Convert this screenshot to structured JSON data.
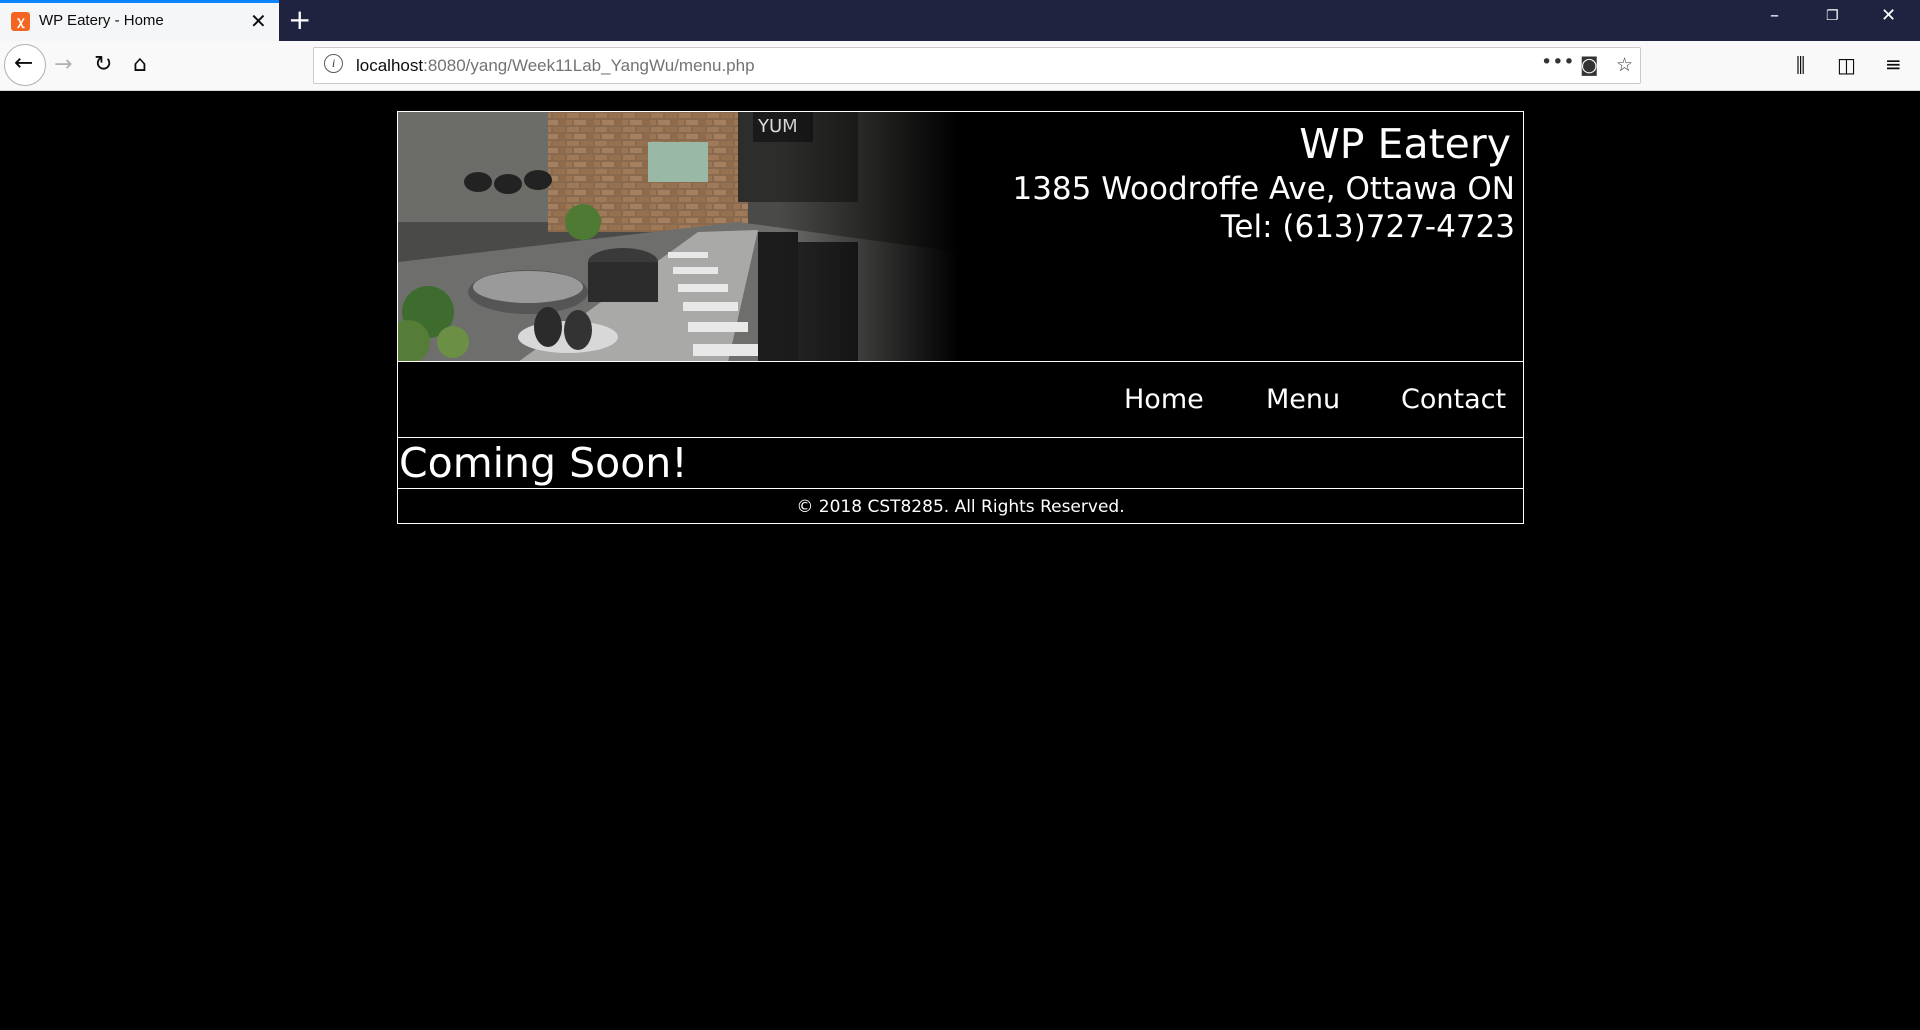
{
  "browser": {
    "tab_title": "WP Eatery - Home",
    "tab_close": "✕",
    "new_tab": "+",
    "url_host": "localhost",
    "url_path": ":8080/yang/Week11Lab_YangWu/menu.php",
    "icons": [
      "back-icon",
      "forward-icon",
      "reload-icon",
      "home-icon",
      "info-icon",
      "page-actions-icon",
      "pocket-icon",
      "bookmark-star-icon",
      "library-icon",
      "sidebar-icon",
      "menu-icon",
      "minimize-icon",
      "restore-icon",
      "close-window-icon"
    ],
    "tab_accent": "#0a84ff"
  },
  "site": {
    "name": "WP Eatery",
    "address": "1385 Woodroffe Ave, Ottawa ON",
    "tel": "Tel: (613)727-4723",
    "nav": [
      "Home",
      "Menu",
      "Contact"
    ],
    "content_title": "Coming Soon!",
    "footer": "© 2018 CST8285. All Rights Reserved.",
    "background": "#000000",
    "text_color": "#ffffff"
  }
}
